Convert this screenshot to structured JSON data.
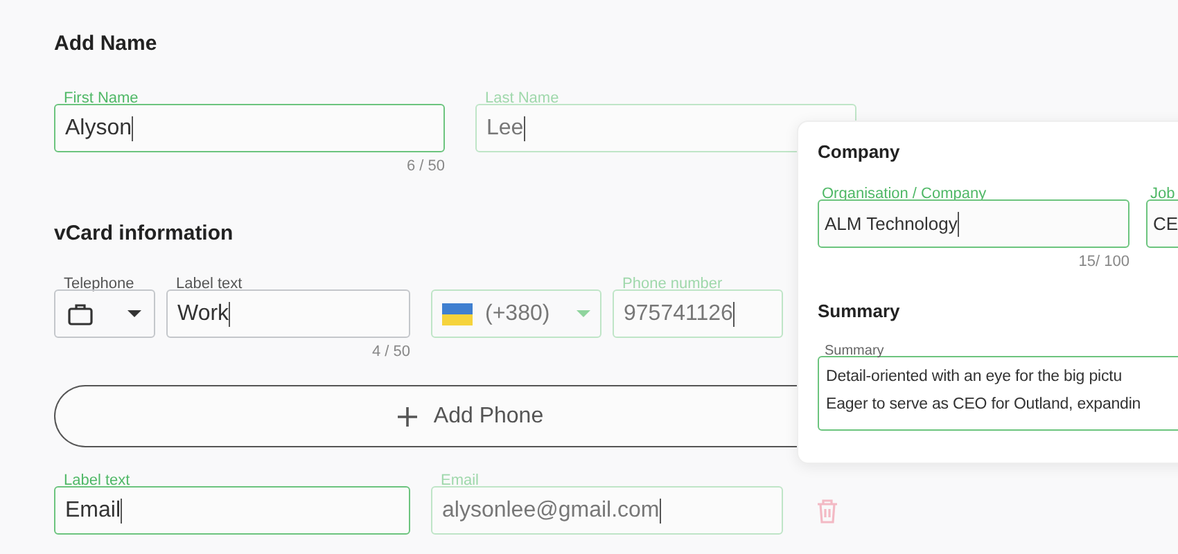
{
  "name_section": {
    "title": "Add Name",
    "fields": [
      {
        "label": "First Name",
        "value": "Alyson",
        "active": true,
        "focused": true,
        "counter": "6 / 50"
      },
      {
        "label": "Last Name",
        "value": "Lee",
        "active": true,
        "focused": false
      }
    ]
  },
  "vcard": {
    "title": "vCard information",
    "phone": {
      "type_label": "Telephone",
      "label_field": {
        "label": "Label text",
        "value": "Work",
        "active": false,
        "counter": "4 / 50"
      },
      "country": {
        "code": "(+380)",
        "active": true,
        "focused": false
      },
      "number": {
        "label": "Phone number",
        "value": "975741126",
        "active": true,
        "focused": false
      }
    },
    "add_phone": "Add Phone",
    "email": [
      {
        "label": "Label text",
        "value": "Email",
        "active": true,
        "focused": true
      },
      {
        "label": "Email",
        "value": "alysonlee@gmail.com",
        "active": true,
        "focused": false
      }
    ]
  },
  "company_card": {
    "title": "Company",
    "fields": [
      {
        "label": "Organisation / Company",
        "value": "ALM Technology",
        "active": true,
        "focused": true,
        "counter": "15/ 100"
      },
      {
        "label": "Job",
        "value": "CE",
        "active": true,
        "focused": true
      }
    ],
    "summary_title": "Summary",
    "summary": {
      "label": "Summary",
      "lines": [
        "Detail-oriented with an eye for the big pictu",
        "Eager to serve as CEO for Outland, expandin"
      ],
      "active": false,
      "focused": true
    }
  }
}
